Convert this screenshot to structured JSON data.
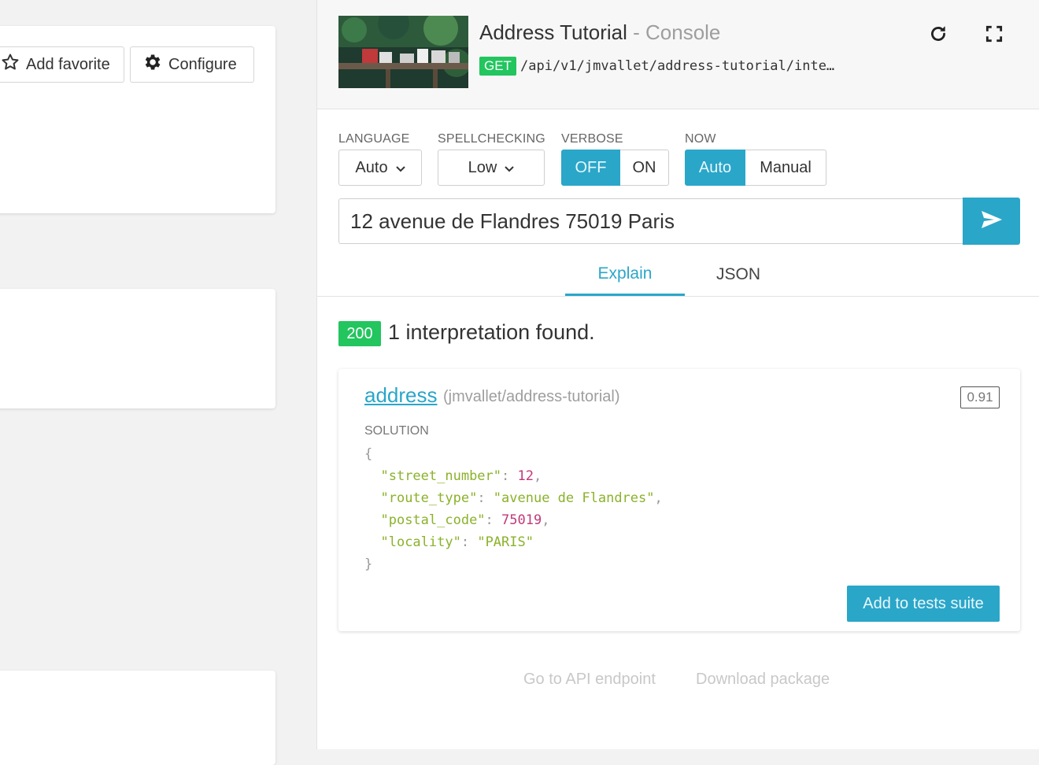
{
  "background_actions": {
    "add_favorite": "Add favorite",
    "configure": "Configure"
  },
  "console": {
    "title": "Address Tutorial",
    "subtitle": "- Console",
    "method": "GET",
    "endpoint": "/api/v1/jmvallet/address-tutorial/inte…",
    "options": {
      "language": {
        "label": "LANGUAGE",
        "value": "Auto"
      },
      "spellchecking": {
        "label": "SPELLCHECKING",
        "value": "Low"
      },
      "verbose": {
        "label": "VERBOSE",
        "options": [
          "OFF",
          "ON"
        ],
        "selected": "OFF"
      },
      "now": {
        "label": "NOW",
        "options": [
          "Auto",
          "Manual"
        ],
        "selected": "Auto"
      }
    },
    "query": "12 avenue de Flandres 75019 Paris",
    "tabs": [
      "Explain",
      "JSON"
    ],
    "active_tab": "Explain",
    "status_code": "200",
    "result_summary": "1 interpretation found.",
    "result": {
      "intent": "address",
      "package": "(jmvallet/address-tutorial)",
      "score": "0.91",
      "solution_label": "SOLUTION",
      "solution": [
        {
          "key": "\"street_number\"",
          "value": "12",
          "type": "number"
        },
        {
          "key": "\"route_type\"",
          "value": "\"avenue de Flandres\"",
          "type": "string"
        },
        {
          "key": "\"postal_code\"",
          "value": "75019",
          "type": "number"
        },
        {
          "key": "\"locality\"",
          "value": "\"PARIS\"",
          "type": "string"
        }
      ],
      "add_tests_label": "Add to tests suite"
    },
    "footer": {
      "api_endpoint": "Go to API endpoint",
      "download": "Download package"
    }
  },
  "colors": {
    "accent": "#2aa6c9",
    "success": "#22c55e"
  }
}
